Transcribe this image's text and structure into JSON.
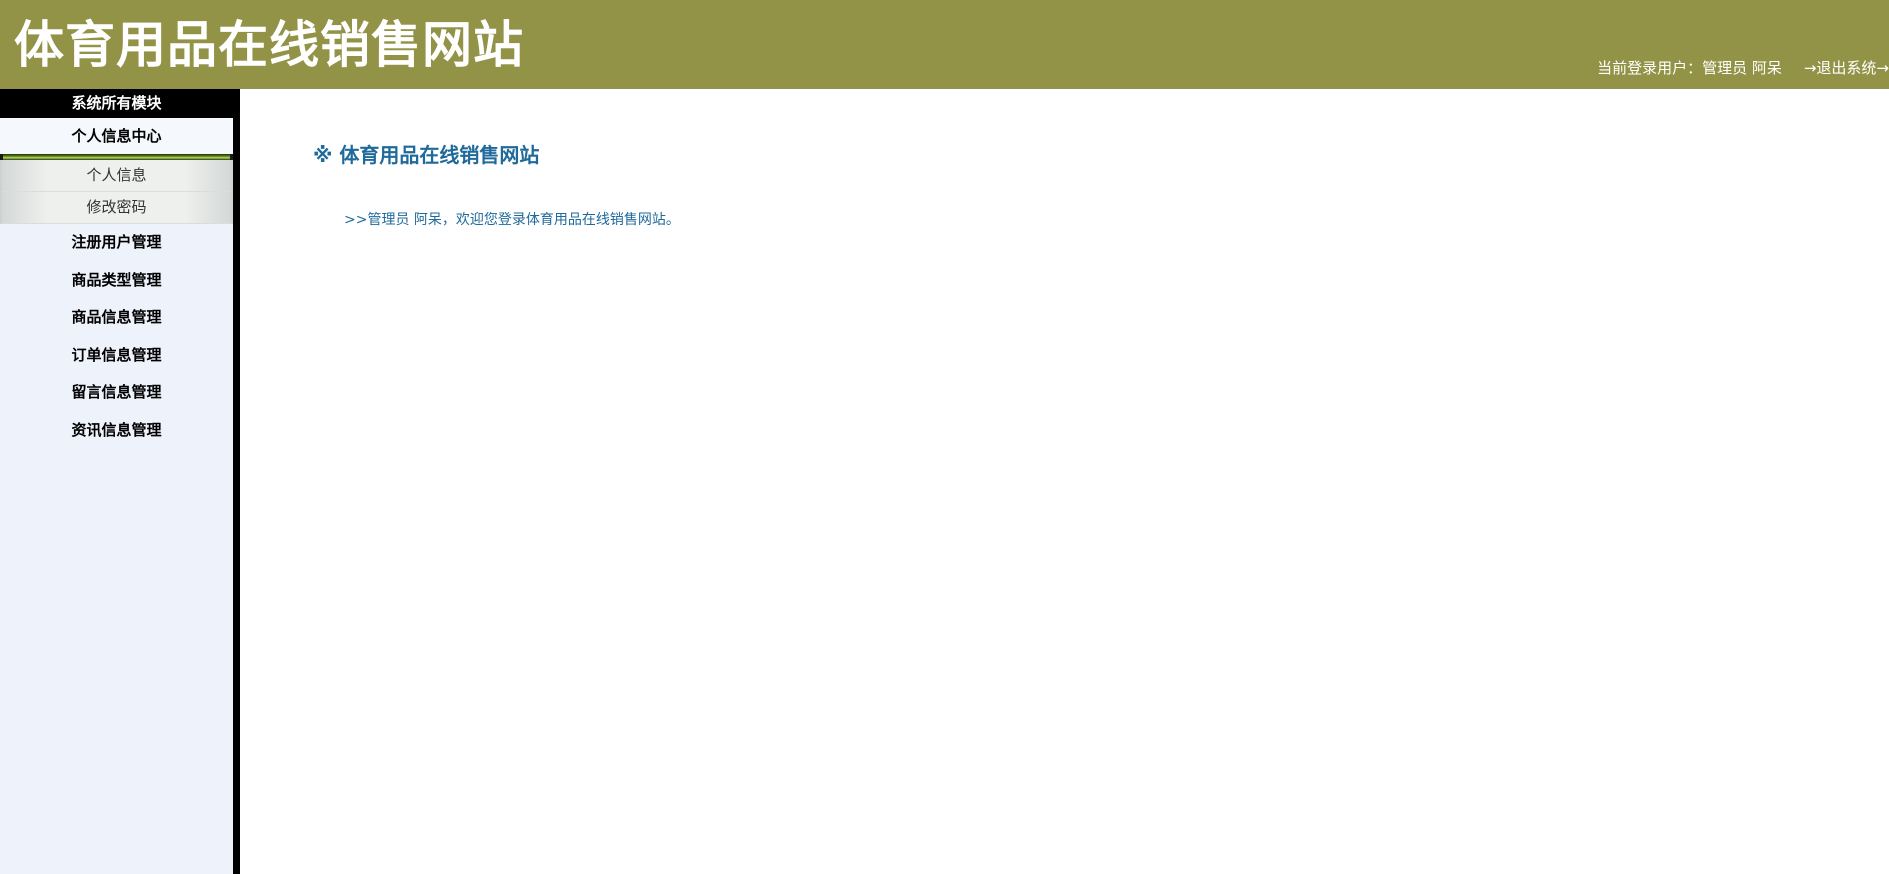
{
  "header": {
    "site_title": "体育用品在线销售网站",
    "user_label": "当前登录用户：管理员 阿呆",
    "logout_label": "→退出系统→"
  },
  "sidebar": {
    "header": "系统所有模块",
    "group_title": "个人信息中心",
    "sub_items": [
      "个人信息",
      "修改密码"
    ],
    "items": [
      "注册用户管理",
      "商品类型管理",
      "商品信息管理",
      "订单信息管理",
      "留言信息管理",
      "资讯信息管理"
    ]
  },
  "main": {
    "title": "※ 体育用品在线销售网站",
    "welcome": ">>管理员 阿呆，欢迎您登录体育用品在线销售网站。"
  },
  "colors": {
    "header_bg": "#939347",
    "sidebar_bg": "#edf2fb",
    "title_blue": "#1f6a9a"
  }
}
